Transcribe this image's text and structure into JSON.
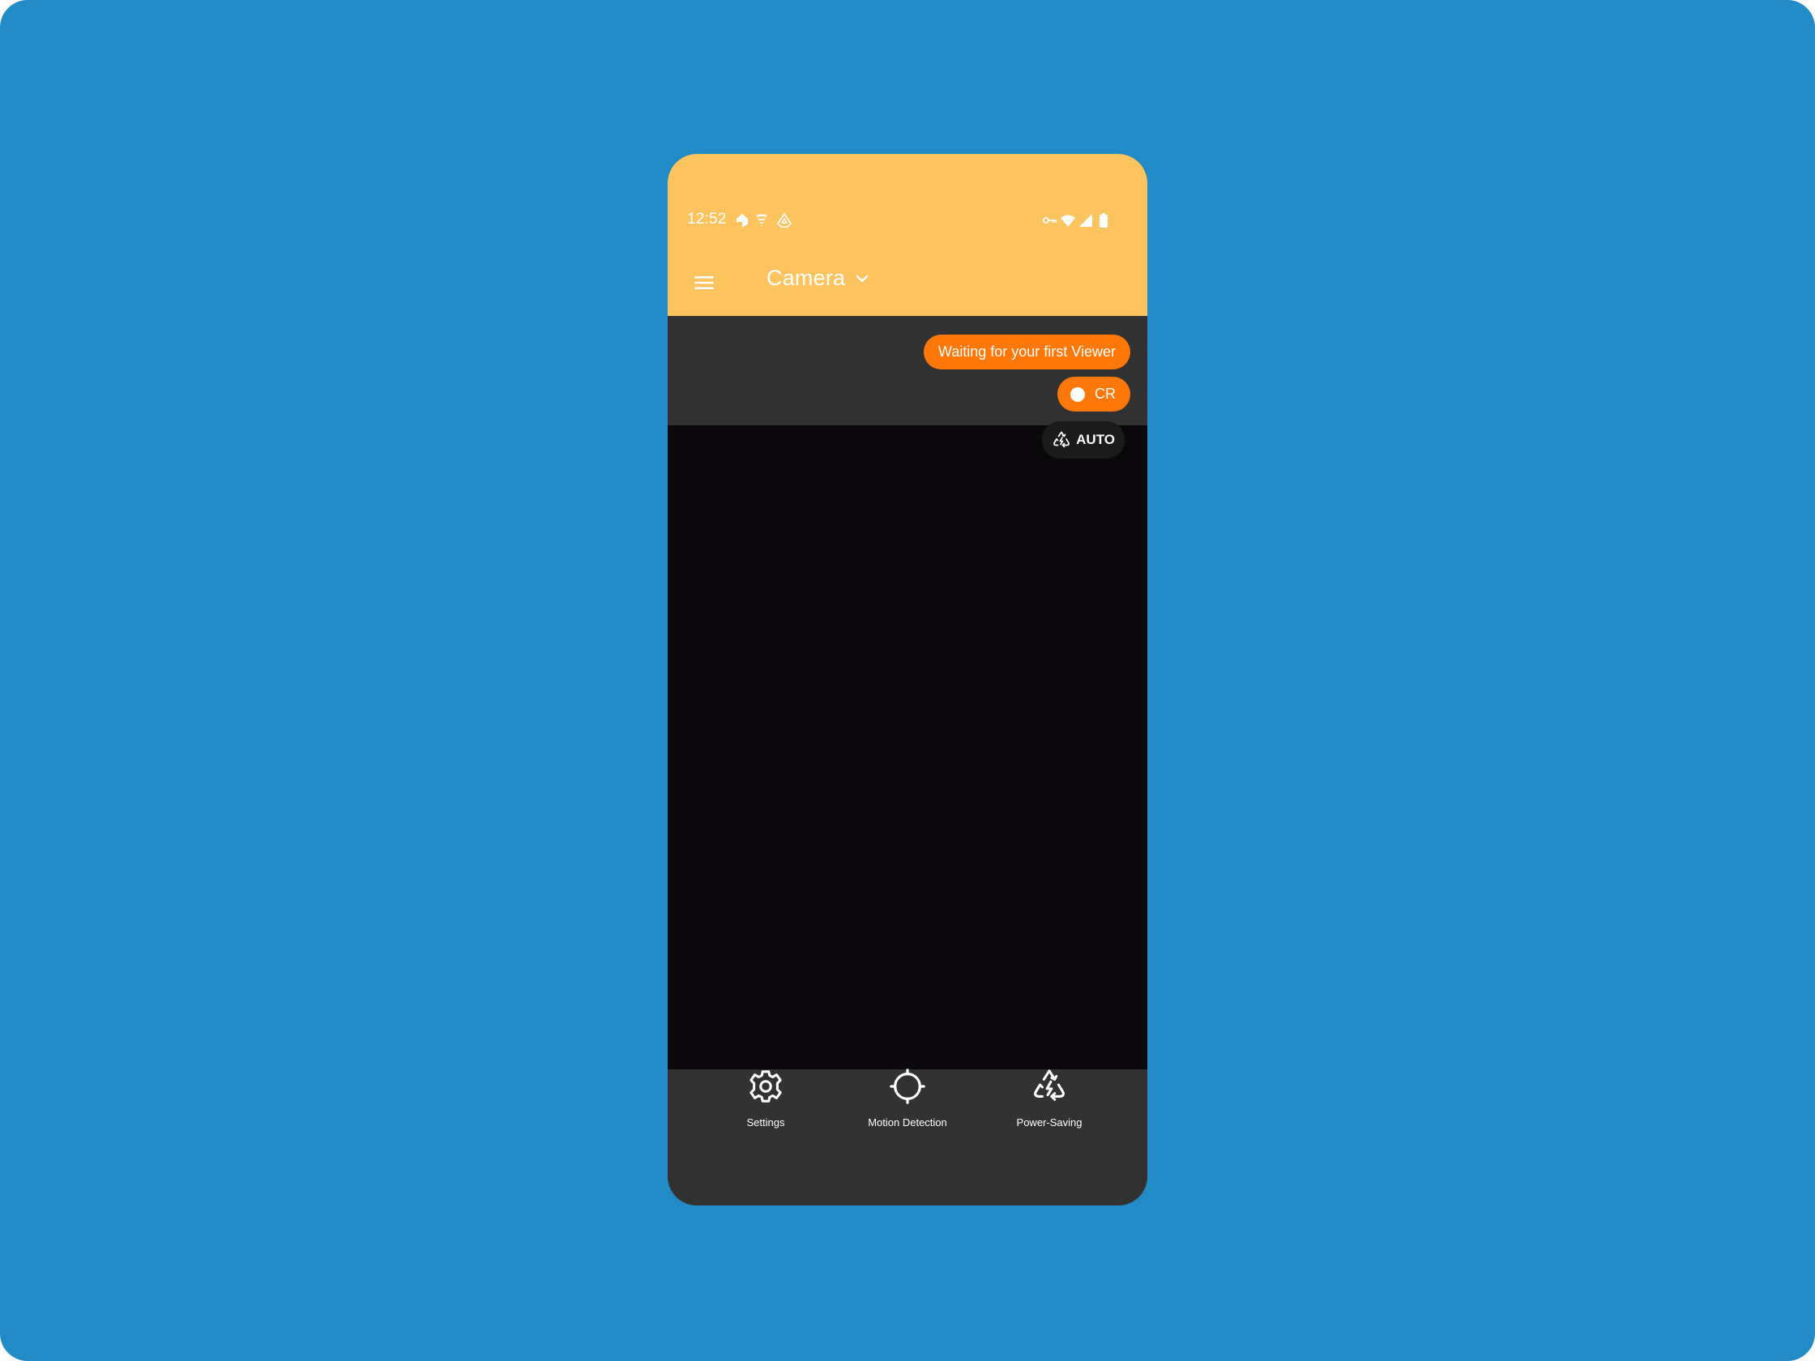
{
  "status_bar": {
    "time": "12:52",
    "left_icons": [
      "home-play-icon",
      "tornado-icon",
      "triangle-badge-icon"
    ],
    "right_icons": [
      "vpn-key-icon",
      "wifi-icon",
      "cellular-signal-icon",
      "battery-icon"
    ]
  },
  "app_bar": {
    "menu_icon": "hamburger-menu-icon",
    "title": "Camera",
    "title_dropdown_icon": "chevron-down-icon",
    "background_color": "#fcc35e"
  },
  "overlay": {
    "viewer_status": "Waiting for your first Viewer",
    "cr_label": "CR",
    "auto_label": "AUTO",
    "auto_icon": "power-saving-icon",
    "accent_color": "#fd7709"
  },
  "bottom_nav": {
    "items": [
      {
        "label": "Settings",
        "icon": "gear-icon"
      },
      {
        "label": "Motion Detection",
        "icon": "crosshair-icon"
      },
      {
        "label": "Power-Saving",
        "icon": "power-saving-icon"
      }
    ]
  }
}
